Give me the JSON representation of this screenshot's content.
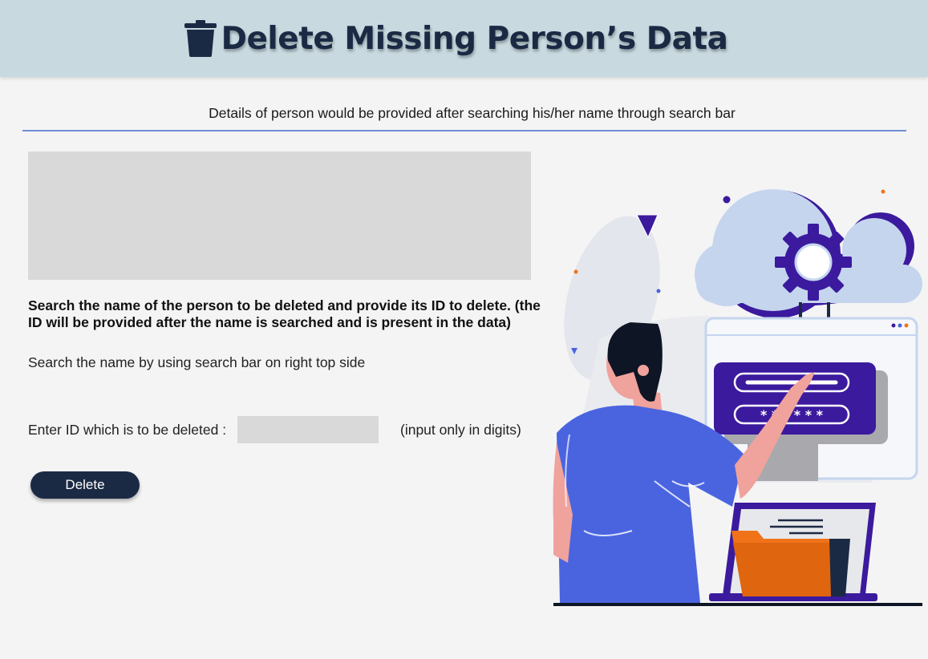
{
  "header": {
    "title": "Delete Missing Person’s Data",
    "icon": "trash-icon"
  },
  "info_text": "Details of person would be provided after searching his/her name through search bar",
  "instructions": {
    "main": "Search the name of the person to be deleted and provide its ID to delete. (the ID will be provided after the name is searched and is present in the data)",
    "hint": "Search the name by using search bar on right top side"
  },
  "delete_form": {
    "id_label": "Enter ID which is to be deleted :",
    "id_value": "",
    "id_note": "(input only in digits)",
    "button_label": "Delete"
  },
  "illustration": {
    "password_mask": "* * * * * *"
  },
  "colors": {
    "header_bg": "#c8d9e0",
    "title": "#1b2a44",
    "button_bg": "#1b2a44",
    "divider": "#6f8fd6",
    "accent_purple": "#3b1a9e",
    "accent_blue": "#4a64e0",
    "accent_orange": "#f07319"
  }
}
